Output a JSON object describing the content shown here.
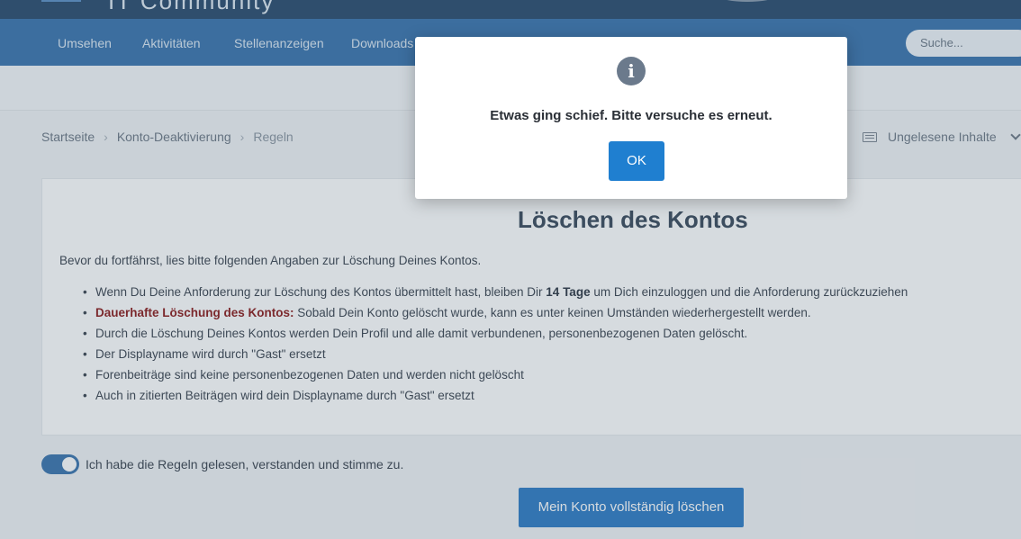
{
  "header": {
    "brand": "IT Community"
  },
  "nav": {
    "items": [
      "Umsehen",
      "Aktivitäten",
      "Stellenanzeigen",
      "Downloads"
    ],
    "search_placeholder": "Suche..."
  },
  "breadcrumb": {
    "items": [
      "Startseite",
      "Konto-Deaktivierung",
      "Regeln"
    ]
  },
  "unread": {
    "label": "Ungelesene Inhalte"
  },
  "card": {
    "title": "Löschen des Kontos",
    "intro": "Bevor du fortfährst, lies bitte folgenden Angaben zur Löschung Deines Kontos.",
    "rule1_pre": "Wenn Du Deine Anforderung zur Löschung des Kontos übermittelt hast, bleiben Dir ",
    "rule1_bold": "14 Tage",
    "rule1_post": " um Dich einzuloggen und die Anforderung zurückzuziehen",
    "rule2_bold": "Dauerhafte Löschung des Kontos:",
    "rule2_post": " Sobald Dein Konto gelöscht wurde, kann es unter keinen Umständen wiederhergestellt werden.",
    "rule3": "Durch die Löschung Deines Kontos werden Dein Profil und alle damit verbundenen, personenbezogenen Daten gelöscht.",
    "rule4": "Der Displayname wird durch \"Gast\" ersetzt",
    "rule5": "Forenbeiträge sind keine personenbezogenen Daten und werden nicht gelöscht",
    "rule6": "Auch in zitierten Beiträgen wird dein Displayname durch \"Gast\" ersetzt"
  },
  "agreement": {
    "label": "Ich habe die Regeln gelesen, verstanden und stimme zu.",
    "checked": true
  },
  "delete_button": "Mein Konto vollständig löschen",
  "modal": {
    "icon": "info-icon",
    "icon_glyph": "i",
    "message": "Etwas ging schief. Bitte versuche es erneut.",
    "ok_label": "OK"
  },
  "colors": {
    "nav_bg": "#3a74ad",
    "accent": "#1f7fd0",
    "danger": "#8b1a1a"
  }
}
